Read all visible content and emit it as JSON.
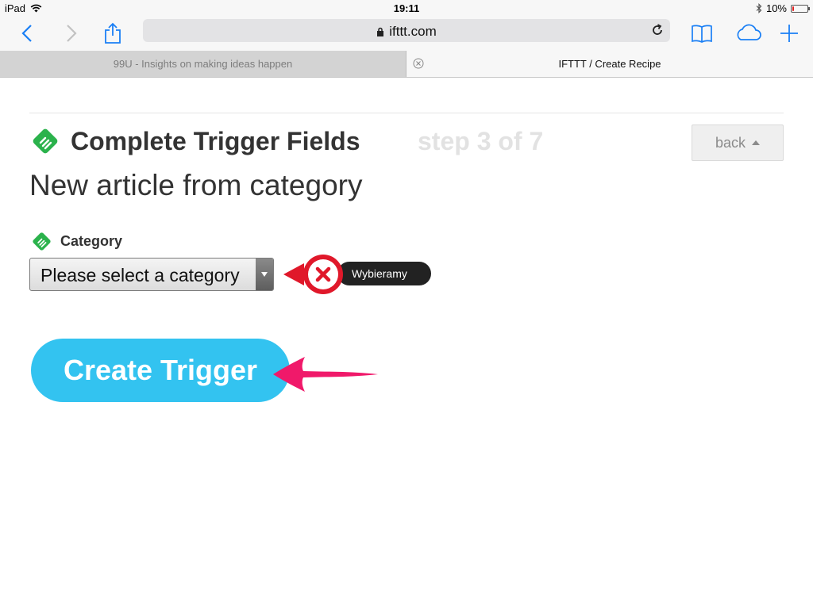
{
  "status_bar": {
    "device": "iPad",
    "time": "19:11",
    "battery": "10%",
    "battery_level": 0.1
  },
  "browser": {
    "url": "ifttt.com",
    "tabs": [
      {
        "label": "99U - Insights on making ideas happen",
        "active": false
      },
      {
        "label": "IFTTT / Create Recipe",
        "active": true
      }
    ],
    "accent_color": "#1a7ff5"
  },
  "page": {
    "title": "Complete Trigger Fields",
    "step": "step 3 of 7",
    "back_label": "back",
    "subtitle": "New article from category",
    "field_label": "Category",
    "select_value": "Please select a category",
    "annotation_label": "Wybieramy",
    "create_button": "Create Trigger",
    "button_color": "#33c3f0",
    "feedly_icon": "feedly-icon",
    "annotation_colors": {
      "x_marker": "#e0182a",
      "arrow": "#f0196a"
    }
  }
}
